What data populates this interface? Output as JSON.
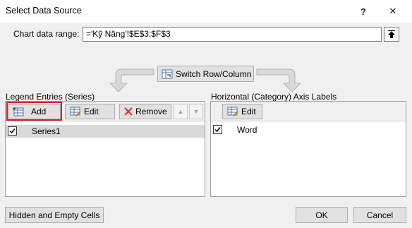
{
  "dialog": {
    "title": "Select Data Source",
    "help_label": "?",
    "close_label": "✕"
  },
  "range": {
    "label": "Chart data range:",
    "value": "='Kỹ Năng'!$E$3:$F$3"
  },
  "switch_button": {
    "label": "Switch Row/Column"
  },
  "legend": {
    "title": "Legend Entries (Series)",
    "add_label": "Add",
    "edit_label": "Edit",
    "remove_label": "Remove",
    "up_label": "▲",
    "down_label": "▼",
    "items": [
      {
        "label": "Series1",
        "checked": true,
        "selected": true
      }
    ]
  },
  "axis": {
    "title": "Horizontal (Category) Axis Labels",
    "edit_label": "Edit",
    "items": [
      {
        "label": "Word",
        "checked": true
      }
    ]
  },
  "footer": {
    "hidden_cells_label": "Hidden and Empty Cells",
    "ok_label": "OK",
    "cancel_label": "Cancel"
  },
  "colors": {
    "highlight": "#d4202b",
    "selected_row": "#d9d9d9"
  }
}
